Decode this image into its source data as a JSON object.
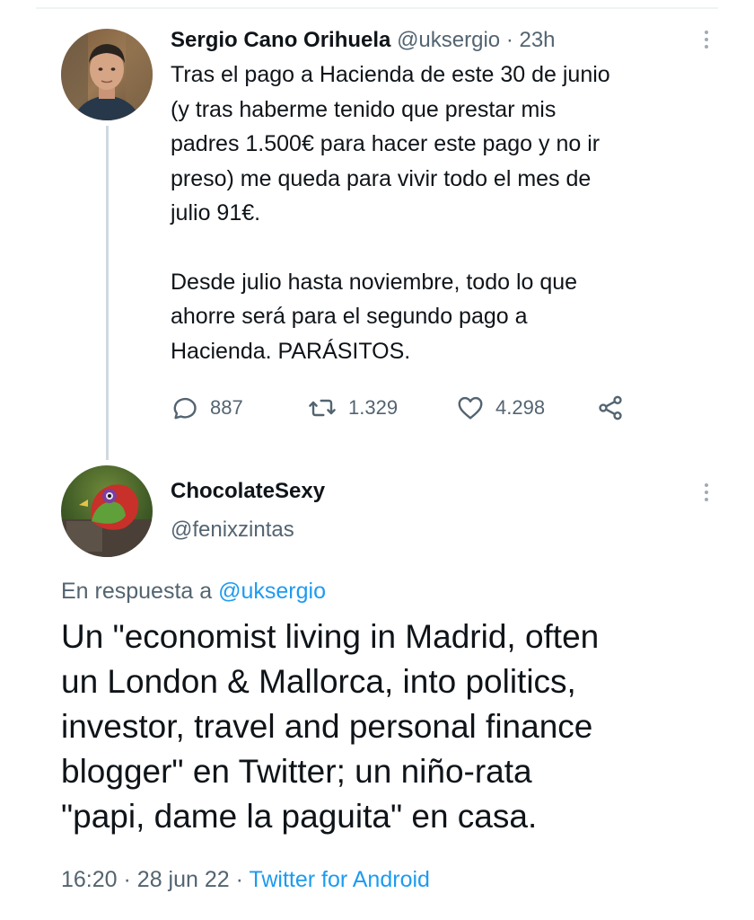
{
  "tweet": {
    "author_name": "Sergio Cano Orihuela",
    "handle": "@uksergio",
    "separator": "·",
    "time": "23h",
    "body_paragraphs": [
      "Tras el pago a Hacienda de este  30 de junio\n(y tras haberme tenido que prestar mis\npadres 1.500€ para hacer este pago y no ir\npreso) me queda para vivir todo el mes de\njulio 91€.",
      "Desde julio hasta noviembre, todo lo que\nahorre será para el segundo pago a\nHacienda. PARÁSITOS."
    ],
    "stats": {
      "replies": "887",
      "retweets": "1.329",
      "likes": "4.298"
    }
  },
  "reply": {
    "author_name": "ChocolateSexy",
    "handle": "@fenixzintas",
    "reply_prefix": "En respuesta a ",
    "reply_mention": "@uksergio",
    "body": "Un \"economist living in Madrid, often\nun London & Mallorca, into politics,\ninvestor, travel and personal finance\nblogger\" en Twitter; un niño-rata\n\"papi, dame la paguita\" en casa.",
    "time": "16:20",
    "date": "28 jun 22",
    "separator": "·",
    "source": "Twitter for Android"
  },
  "colors": {
    "text_primary": "#0f1419",
    "text_secondary": "#536471",
    "accent": "#1d9bf0",
    "thread_line": "#cfd9de"
  },
  "icons": {
    "reply": "speech-bubble-icon",
    "retweet": "retweet-arrows-icon",
    "like": "heart-outline-icon",
    "share": "share-nodes-icon",
    "more": "vertical-ellipsis-icon"
  }
}
